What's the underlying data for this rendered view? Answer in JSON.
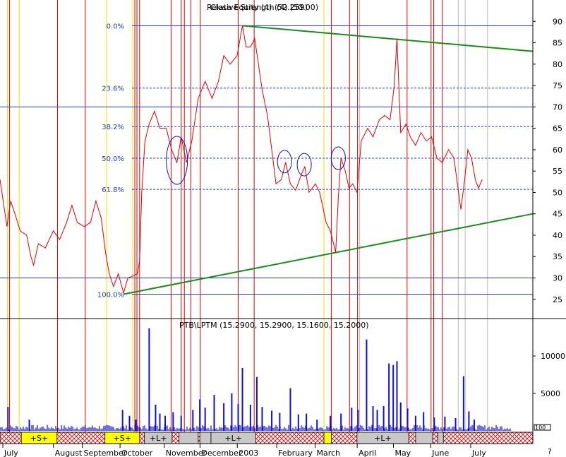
{
  "chart_data": [
    {
      "type": "line",
      "title": "Relative Strength (4) (50.00)",
      "title_overlap": "Close Equity (4) (52.259)",
      "y_axis": {
        "ticks": [
          25,
          30,
          35,
          40,
          45,
          50,
          55,
          60,
          65,
          70,
          75,
          80,
          85,
          90
        ],
        "range": [
          20.5,
          95
        ],
        "side": "right"
      },
      "fib_levels": [
        {
          "label": "0.0%",
          "value": 89
        },
        {
          "label": "23.6%",
          "value": 74.4
        },
        {
          "label": "38.2%",
          "value": 65.4
        },
        {
          "label": "50.0%",
          "value": 58
        },
        {
          "label": "61.8%",
          "value": 50.7
        },
        {
          "label": "100.0%",
          "value": 26.2
        }
      ],
      "horizontal_lines": [
        70,
        30
      ],
      "trendlines": [
        {
          "name": "upper",
          "from": [
            0.455,
            89
          ],
          "to": [
            1.0,
            83
          ]
        },
        {
          "name": "lower",
          "from": [
            0.232,
            26.2
          ],
          "to": [
            1.0,
            45
          ]
        }
      ],
      "ellipses": [
        {
          "x": 0.332,
          "y": 57.5
        },
        {
          "x": 0.534,
          "y": 57.2
        },
        {
          "x": 0.571,
          "y": 56.5
        },
        {
          "x": 0.635,
          "y": 58
        }
      ],
      "series": [
        {
          "color": "#e00000",
          "points": [
            [
              0.0,
              53
            ],
            [
              0.013,
              42
            ],
            [
              0.02,
              48
            ],
            [
              0.028,
              45
            ],
            [
              0.038,
              41
            ],
            [
              0.05,
              40
            ],
            [
              0.058,
              35
            ],
            [
              0.063,
              33
            ],
            [
              0.072,
              38
            ],
            [
              0.085,
              37
            ],
            [
              0.1,
              41
            ],
            [
              0.112,
              39
            ],
            [
              0.125,
              43
            ],
            [
              0.135,
              47
            ],
            [
              0.145,
              43
            ],
            [
              0.158,
              42
            ],
            [
              0.17,
              43
            ],
            [
              0.18,
              48
            ],
            [
              0.19,
              44
            ],
            [
              0.198,
              36
            ],
            [
              0.205,
              31
            ],
            [
              0.213,
              28
            ],
            [
              0.222,
              31
            ],
            [
              0.232,
              26.5
            ],
            [
              0.24,
              30
            ],
            [
              0.25,
              30.5
            ],
            [
              0.258,
              31
            ],
            [
              0.262,
              34
            ],
            [
              0.266,
              50
            ],
            [
              0.272,
              62
            ],
            [
              0.28,
              66
            ],
            [
              0.29,
              69
            ],
            [
              0.3,
              65
            ],
            [
              0.312,
              65
            ],
            [
              0.322,
              60
            ],
            [
              0.332,
              57
            ],
            [
              0.34,
              63
            ],
            [
              0.35,
              57
            ],
            [
              0.36,
              62
            ],
            [
              0.372,
              72
            ],
            [
              0.385,
              76
            ],
            [
              0.398,
              72
            ],
            [
              0.41,
              76
            ],
            [
              0.42,
              82
            ],
            [
              0.432,
              80
            ],
            [
              0.445,
              82
            ],
            [
              0.455,
              89
            ],
            [
              0.462,
              84
            ],
            [
              0.47,
              84
            ],
            [
              0.478,
              86
            ],
            [
              0.485,
              80
            ],
            [
              0.492,
              74
            ],
            [
              0.502,
              68
            ],
            [
              0.51,
              60
            ],
            [
              0.518,
              52
            ],
            [
              0.528,
              53
            ],
            [
              0.536,
              57
            ],
            [
              0.545,
              52
            ],
            [
              0.555,
              50.5
            ],
            [
              0.565,
              54
            ],
            [
              0.572,
              56
            ],
            [
              0.58,
              50
            ],
            [
              0.592,
              52
            ],
            [
              0.6,
              50
            ],
            [
              0.612,
              43
            ],
            [
              0.62,
              41
            ],
            [
              0.63,
              36
            ],
            [
              0.635,
              49
            ],
            [
              0.64,
              58
            ],
            [
              0.648,
              55
            ],
            [
              0.655,
              51
            ],
            [
              0.662,
              52
            ],
            [
              0.67,
              50
            ],
            [
              0.678,
              62
            ],
            [
              0.69,
              65
            ],
            [
              0.7,
              63
            ],
            [
              0.712,
              67
            ],
            [
              0.722,
              68
            ],
            [
              0.732,
              67
            ],
            [
              0.74,
              75
            ],
            [
              0.745,
              86
            ],
            [
              0.752,
              64
            ],
            [
              0.762,
              66
            ],
            [
              0.77,
              63
            ],
            [
              0.78,
              61
            ],
            [
              0.79,
              64
            ],
            [
              0.8,
              62
            ],
            [
              0.81,
              63
            ],
            [
              0.82,
              58
            ],
            [
              0.83,
              57
            ],
            [
              0.842,
              60
            ],
            [
              0.852,
              58
            ],
            [
              0.865,
              46
            ],
            [
              0.872,
              53
            ],
            [
              0.878,
              60
            ],
            [
              0.885,
              58
            ],
            [
              0.892,
              53
            ],
            [
              0.898,
              51
            ],
            [
              0.905,
              53
            ]
          ]
        }
      ]
    },
    {
      "type": "bar",
      "title": "PTB\\LPTM (15.2900, 15.2900, 15.1600, 15.2000)",
      "y_axis": {
        "ticks": [
          5000,
          10000
        ],
        "range": [
          0,
          15000
        ],
        "side": "right"
      },
      "extra_tick": "100",
      "spikes": [
        [
          0.015,
          3200
        ],
        [
          0.055,
          1500
        ],
        [
          0.23,
          2800
        ],
        [
          0.243,
          2000
        ],
        [
          0.255,
          1500
        ],
        [
          0.28,
          13700
        ],
        [
          0.292,
          3500
        ],
        [
          0.3,
          2300
        ],
        [
          0.31,
          2000
        ],
        [
          0.325,
          2500
        ],
        [
          0.34,
          2000
        ],
        [
          0.362,
          2800
        ],
        [
          0.375,
          4200
        ],
        [
          0.385,
          3100
        ],
        [
          0.402,
          4800
        ],
        [
          0.42,
          3700
        ],
        [
          0.435,
          5000
        ],
        [
          0.447,
          3600
        ],
        [
          0.455,
          8400
        ],
        [
          0.47,
          3500
        ],
        [
          0.482,
          7200
        ],
        [
          0.492,
          3200
        ],
        [
          0.51,
          2700
        ],
        [
          0.525,
          2400
        ],
        [
          0.545,
          5700
        ],
        [
          0.56,
          2200
        ],
        [
          0.575,
          2300
        ],
        [
          0.595,
          1500
        ],
        [
          0.62,
          2000
        ],
        [
          0.64,
          2300
        ],
        [
          0.66,
          3100
        ],
        [
          0.672,
          2800
        ],
        [
          0.688,
          12200
        ],
        [
          0.7,
          3300
        ],
        [
          0.708,
          2800
        ],
        [
          0.72,
          3300
        ],
        [
          0.73,
          9000
        ],
        [
          0.738,
          8800
        ],
        [
          0.745,
          9300
        ],
        [
          0.752,
          3800
        ],
        [
          0.765,
          3000
        ],
        [
          0.78,
          2000
        ],
        [
          0.795,
          2500
        ],
        [
          0.815,
          1800
        ],
        [
          0.835,
          1900
        ],
        [
          0.855,
          1700
        ],
        [
          0.87,
          7300
        ],
        [
          0.88,
          2600
        ],
        [
          0.89,
          1500
        ]
      ]
    }
  ],
  "x_axis": {
    "months": [
      {
        "label": "July",
        "x": 0.008
      },
      {
        "label": "August",
        "x": 0.103
      },
      {
        "label": "September",
        "x": 0.157
      },
      {
        "label": "October",
        "x": 0.228
      },
      {
        "label": "November",
        "x": 0.311
      },
      {
        "label": "December",
        "x": 0.378
      },
      {
        "label": "2003",
        "x": 0.448
      },
      {
        "label": "February",
        "x": 0.522
      },
      {
        "label": "March",
        "x": 0.594
      },
      {
        "label": "April",
        "x": 0.673
      },
      {
        "label": "May",
        "x": 0.741
      },
      {
        "label": "June",
        "x": 0.811
      },
      {
        "label": "July",
        "x": 0.886
      }
    ],
    "corner_mark": "?"
  },
  "position_bands": [
    {
      "label": "+S+",
      "from": 0.04,
      "to": 0.107,
      "kind": "short"
    },
    {
      "label": "+S+",
      "from": 0.197,
      "to": 0.262,
      "kind": "short"
    },
    {
      "label": "+L+",
      "from": 0.271,
      "to": 0.323,
      "kind": "long"
    },
    {
      "label": "+L+",
      "from": 0.396,
      "to": 0.48,
      "kind": "long"
    },
    {
      "label": "+L+",
      "from": 0.67,
      "to": 0.767,
      "kind": "long"
    }
  ],
  "band_gray": [
    [
      0.336,
      0.372
    ],
    [
      0.375,
      0.396
    ],
    [
      0.78,
      0.812
    ],
    [
      0.822,
      0.832
    ]
  ],
  "band_yellow_small": [
    [
      0.608,
      0.622
    ]
  ],
  "vertical_lines": {
    "red": [
      0.018,
      0.108,
      0.16,
      0.253,
      0.257,
      0.262,
      0.321,
      0.34,
      0.346,
      0.358,
      0.376,
      0.447,
      0.477,
      0.622,
      0.656,
      0.671,
      0.764,
      0.809,
      0.814,
      0.83
    ],
    "yellow": [
      0.014,
      0.036,
      0.2,
      0.249,
      0.608
    ],
    "gray": [
      0.675,
      0.86,
      0.873,
      0.915
    ]
  },
  "colors": {
    "price": "#e00000",
    "trend": "#1a8a1a",
    "fib": "#1f3fbf",
    "volume": "#1010d0",
    "band_short": "#ffff00",
    "band_long": "#c8c8c8",
    "band_hatch": "#d40000"
  }
}
